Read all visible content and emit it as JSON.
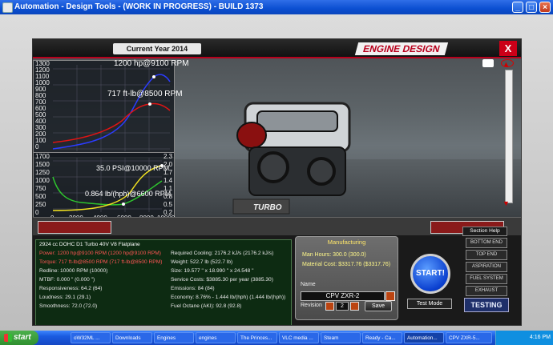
{
  "window": {
    "title": "Automation - Design Tools - (WORK IN PROGRESS) - BUILD 1373"
  },
  "header": {
    "year": "Current Year 2014",
    "section_title": "ENGINE DESIGN",
    "close": "X"
  },
  "graph_power_torque": {
    "power_peak": "1200 hp@9100 RPM",
    "torque_peak": "717 ft-lb@8500 RPM",
    "y_ticks": [
      "1300",
      "1200",
      "1100",
      "1000",
      "900",
      "800",
      "700",
      "600",
      "500",
      "400",
      "300",
      "200",
      "100",
      "0"
    ]
  },
  "graph_boost": {
    "boost_peak": "35.0 PSI@10000 RPM",
    "econ_min": "0.864 lb/(hph)@6600 RPM",
    "y_ticks": [
      "1700",
      "1500",
      "1250",
      "1000",
      "750",
      "500",
      "250",
      "0"
    ],
    "x_ticks": [
      "0",
      "2000",
      "4000",
      "6000",
      "8000",
      "10000"
    ],
    "r_ticks": [
      "2.3",
      "2.0",
      "1.7",
      "1.4",
      "1.1",
      "0.8",
      "0.5",
      "0.2"
    ]
  },
  "info": {
    "engine_name": "2924 cc DOHC D1 Turbo 40V V8 Flatplane",
    "power": "Power: 1200 hp@9100 RPM (1200 hp@9100 RPM)",
    "torque": "Torque: 717 ft-lb@8500 RPM (717 ft-lb@8500 RPM)",
    "redline": "Redline: 10000 RPM (10000)",
    "mtbf": "MTBF: 0.000 \" (0.000 \")",
    "responsiveness": "Responsiveness: 64.2 (64)",
    "loudness": "Loudness: 29.1 (29.1)",
    "smoothness": "Smoothness: 72.0 (72.0)",
    "cooling": "Required Cooling: 2176.2 kJ/s (2176.2 kJ/s)",
    "weight": "Weight: 522.7 lb (522.7 lb)",
    "size": "Size: 19.577 \" x 18.990 \" x 24.548 \"",
    "service": "Service Costs: $3885.30 per year (3885.30)",
    "emissions": "Emissions: 84 (84)",
    "economy": "Economy: 8.76% - 1.444 lb/(hph) (1.444 lb/(hph))",
    "octane": "Fuel Octane (AKI): 92.8 (92.8)"
  },
  "manufacturing": {
    "title": "Manufacturing",
    "man_hours": "Man Hours: 300.0 (300.0)",
    "material_cost": "Material Cost: $3317.76 ($3317.76)",
    "name_label": "Name",
    "name_value": "CPV ZXR-2",
    "revision_label": "Revision",
    "revision_value": "2",
    "save": "Save"
  },
  "controls": {
    "start": "START!",
    "test_mode": "Test Mode",
    "section_help": "Section Help"
  },
  "menu": [
    "BOTTOM END",
    "TOP END",
    "ASPIRATION",
    "FUEL SYSTEM",
    "EXHAUST"
  ],
  "testing": "TESTING",
  "taskbar": {
    "start": "start",
    "items": [
      "oW32ML ...",
      "Downloads",
      "Engines",
      "engines",
      "The Princes...",
      "VLC media ...",
      "Steam",
      "Ready - Ca...",
      "Automation...",
      "CPV ZXR-5..."
    ],
    "clock": "4:16 PM"
  },
  "colors": {
    "accent_red": "#b8001c",
    "power_line": "#2b3cff",
    "torque_line": "#e01414",
    "boost_line": "#f0e020",
    "econ_line": "#2ec42e"
  }
}
